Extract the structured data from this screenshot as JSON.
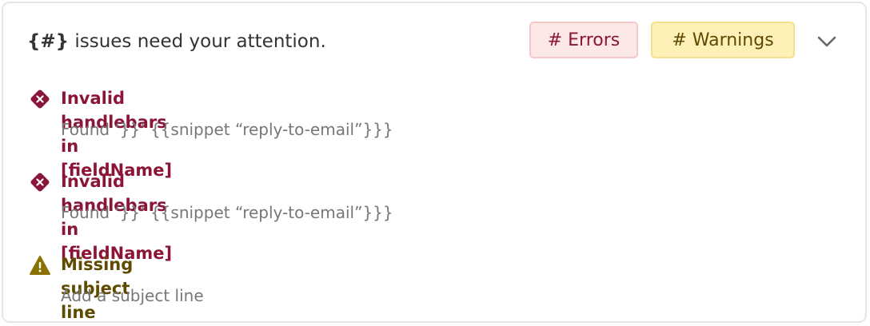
{
  "header": {
    "count_placeholder": "{#}",
    "title_rest": " issues need your attention."
  },
  "badges": {
    "errors": "# Errors",
    "warnings": "# Warnings"
  },
  "issues": [
    {
      "type": "error",
      "title": "Invalid handlebars in [fieldName]",
      "detail": "Found ‘}}’ {{snippet “reply-to-email”}}}"
    },
    {
      "type": "error",
      "title": "Invalid handlebars in [fieldName]",
      "detail": "Found ‘}}’ {{snippet “reply-to-email”}}}"
    },
    {
      "type": "warning",
      "title": "Missing subject line",
      "detail": "Add a subject line"
    }
  ],
  "icons": {
    "expand": "chevron-down-icon",
    "error": "error-diamond-icon",
    "warning": "warning-triangle-icon"
  },
  "colors": {
    "error_text": "#8a1538",
    "error_badge_bg": "#fde8e8",
    "warning_text": "#5f4a00",
    "warning_badge_bg": "#fdf1b8",
    "warning_icon": "#8a7200"
  }
}
